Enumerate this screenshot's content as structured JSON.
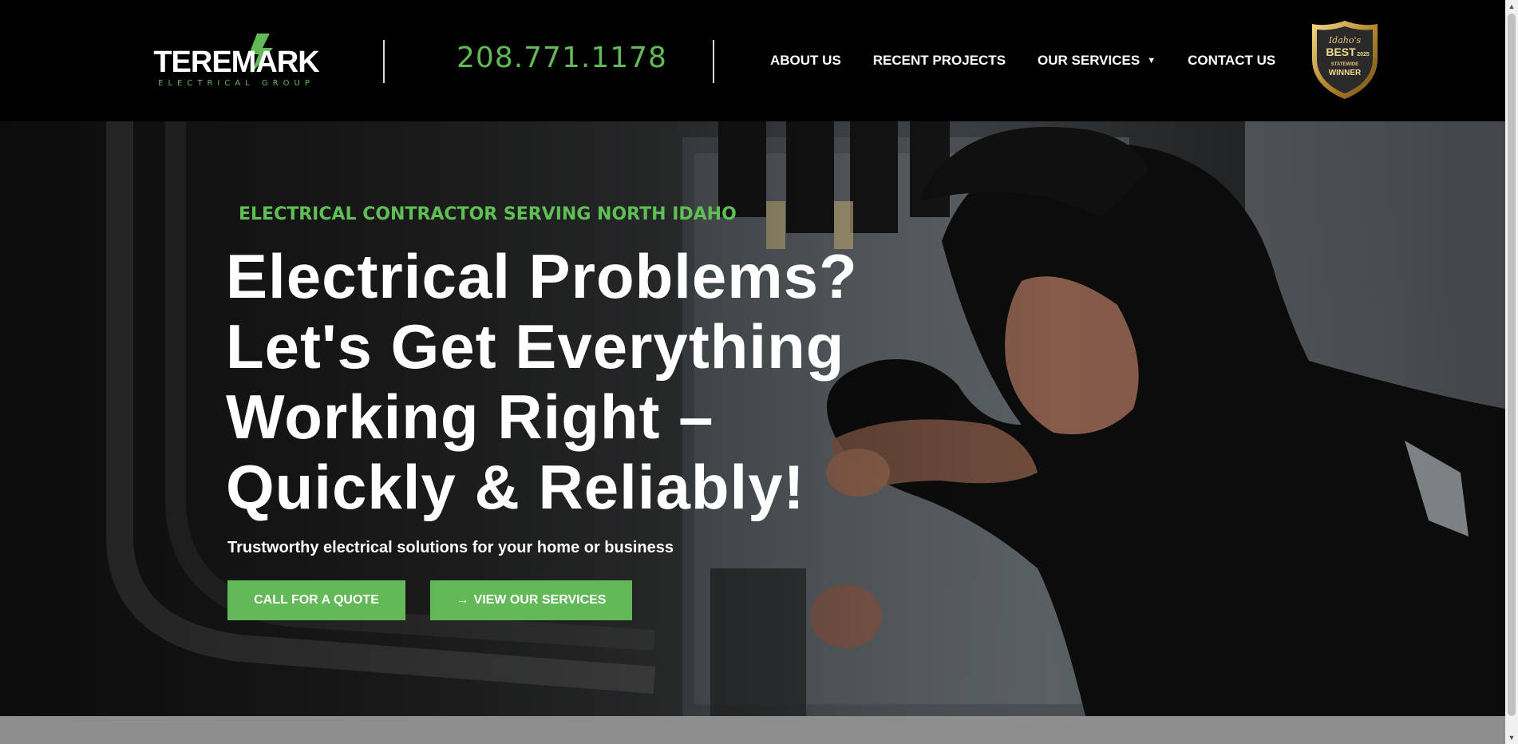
{
  "header": {
    "logo": {
      "name": "TEREMARK",
      "tagline": "ELECTRICAL GROUP",
      "icon": "lightning-bolt-icon"
    },
    "phone": "208.771.1178",
    "nav": [
      {
        "label": "ABOUT US"
      },
      {
        "label": "RECENT PROJECTS"
      },
      {
        "label": "OUR SERVICES",
        "has_dropdown": true
      },
      {
        "label": "CONTACT US"
      }
    ],
    "badge": {
      "line1": "Idaho's",
      "line2": "BEST",
      "year": "2025",
      "line3": "STATEWIDE",
      "line4": "WINNER"
    }
  },
  "hero": {
    "eyebrow": "ELECTRICAL CONTRACTOR SERVING NORTH IDAHO",
    "headline": [
      "Electrical Problems?",
      "Let's Get Everything",
      "Working Right –",
      "Quickly & Reliably!"
    ],
    "subline": "Trustworthy electrical solutions for your home or business",
    "buttons": {
      "quote": "CALL FOR A QUOTE",
      "services": "VIEW OUR SERVICES",
      "services_icon": "arrow-right-icon"
    }
  },
  "colors": {
    "accent_green": "#63b858",
    "header_bg": "#000000",
    "text": "#ffffff"
  }
}
